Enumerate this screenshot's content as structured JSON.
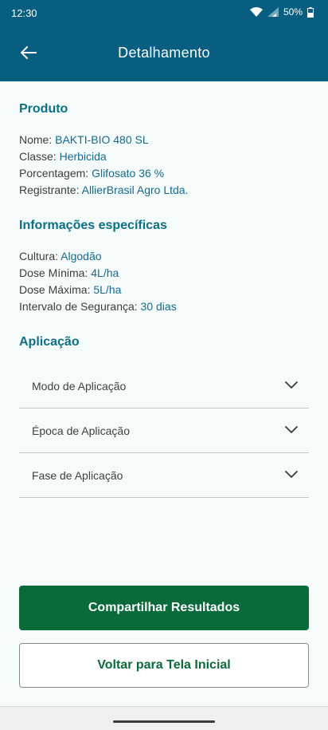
{
  "status_bar": {
    "time": "12:30",
    "battery": "50%"
  },
  "app_bar": {
    "title": "Detalhamento"
  },
  "produto": {
    "title": "Produto",
    "fields": [
      {
        "label": "Nome: ",
        "value": "BAKTI-BIO 480 SL"
      },
      {
        "label": "Classe: ",
        "value": "Herbicida"
      },
      {
        "label": "Porcentagem: ",
        "value": "Glifosato 36 %"
      },
      {
        "label": "Registrante: ",
        "value": "AllierBrasil Agro Ltda."
      }
    ]
  },
  "especificas": {
    "title": "Informações específicas",
    "fields": [
      {
        "label": "Cultura: ",
        "value": "Algodão"
      },
      {
        "label": "Dose Mínima: ",
        "value": "4L/ha"
      },
      {
        "label": "Dose Máxima: ",
        "value": "5L/ha"
      },
      {
        "label": "Intervalo de Segurança: ",
        "value": "30 dias"
      }
    ]
  },
  "aplicacao": {
    "title": "Aplicação",
    "items": [
      {
        "label": "Modo de Aplicação"
      },
      {
        "label": "Época de Aplicação"
      },
      {
        "label": "Fase de Aplicação"
      }
    ]
  },
  "actions": {
    "share_label": "Compartilhar Resultados",
    "home_label": "Voltar para Tela Inicial"
  },
  "colors": {
    "header": "#075e80",
    "section_title": "#0c6f86",
    "value_text": "#176a8e",
    "primary_button": "#0a6a3a"
  },
  "icons": {
    "back": "arrow-left-icon",
    "wifi": "wifi-icon",
    "signal": "signal-icon",
    "battery": "battery-icon",
    "expand": "chevron-down-icon"
  }
}
